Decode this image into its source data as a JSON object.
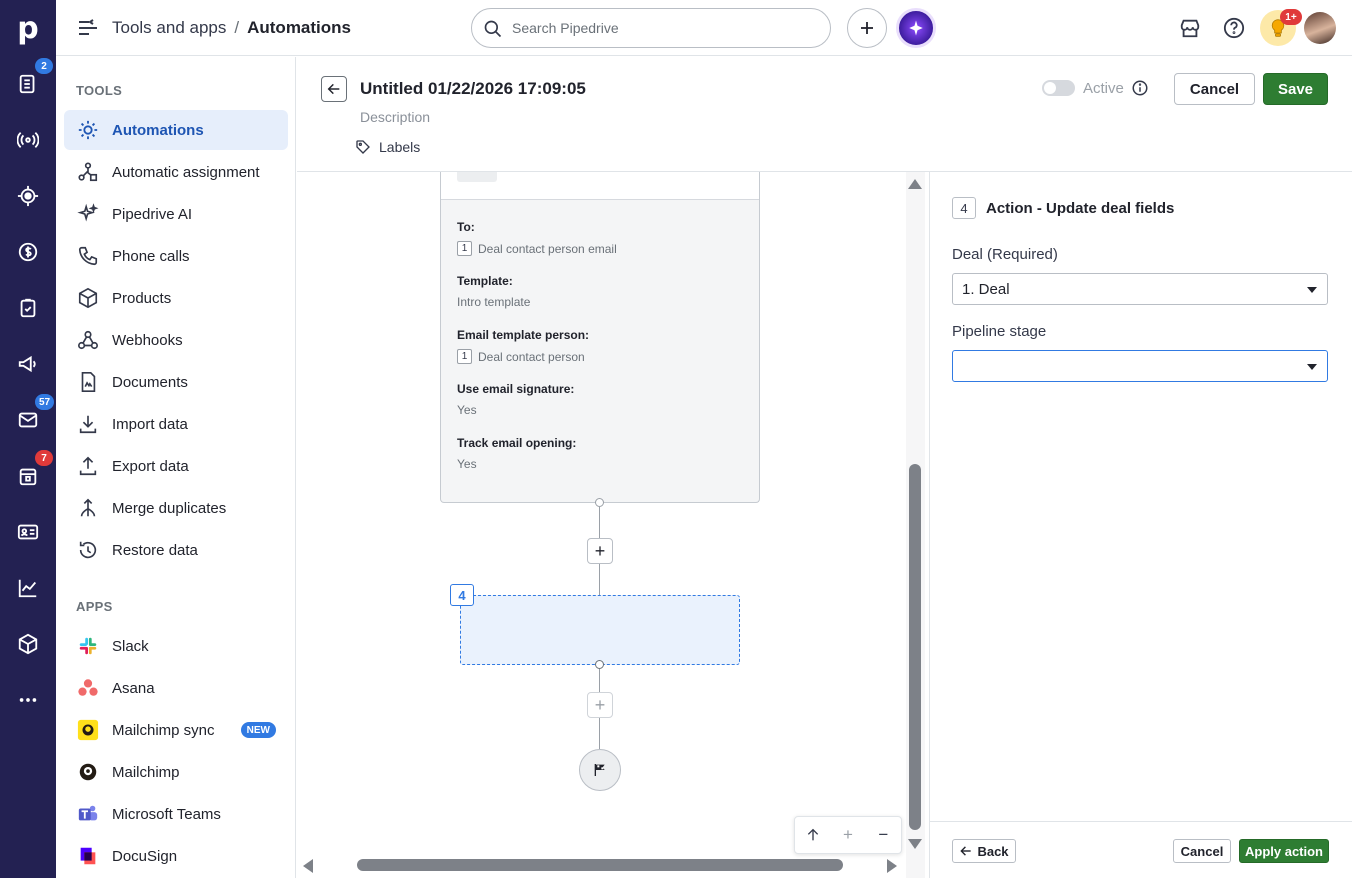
{
  "rail": {
    "logo": "p",
    "badges": {
      "deals": "2",
      "mail": "57",
      "calendar": "7"
    }
  },
  "header": {
    "breadcrumb_parent": "Tools and apps",
    "breadcrumb_sep": "/",
    "breadcrumb_current": "Automations",
    "search_placeholder": "Search Pipedrive",
    "notifications_badge": "1+"
  },
  "sidenav": {
    "tools_title": "TOOLS",
    "tools": [
      {
        "label": "Automations",
        "icon": "automation-icon"
      },
      {
        "label": "Automatic assignment",
        "icon": "assignment-icon"
      },
      {
        "label": "Pipedrive AI",
        "icon": "sparkle-icon"
      },
      {
        "label": "Phone calls",
        "icon": "phone-icon"
      },
      {
        "label": "Products",
        "icon": "box-icon"
      },
      {
        "label": "Webhooks",
        "icon": "webhook-icon"
      },
      {
        "label": "Documents",
        "icon": "document-icon"
      },
      {
        "label": "Import data",
        "icon": "import-icon"
      },
      {
        "label": "Export data",
        "icon": "export-icon"
      },
      {
        "label": "Merge duplicates",
        "icon": "merge-icon"
      },
      {
        "label": "Restore data",
        "icon": "restore-icon"
      }
    ],
    "apps_title": "APPS",
    "apps": [
      {
        "label": "Slack",
        "icon": "slack-icon"
      },
      {
        "label": "Asana",
        "icon": "asana-icon"
      },
      {
        "label": "Mailchimp sync",
        "icon": "mailchimp-icon",
        "badge": "NEW"
      },
      {
        "label": "Mailchimp",
        "icon": "mailchimp-icon"
      },
      {
        "label": "Microsoft Teams",
        "icon": "teams-icon"
      },
      {
        "label": "DocuSign",
        "icon": "docusign-icon"
      }
    ]
  },
  "editor": {
    "title": "Untitled 01/22/2026 17:09:05",
    "description_placeholder": "Description",
    "labels": "Labels",
    "active_label": "Active",
    "cancel": "Cancel",
    "save": "Save"
  },
  "card": {
    "to_label": "To:",
    "to_num": "1",
    "to_value": "Deal contact person email",
    "template_label": "Template:",
    "template_value": "Intro template",
    "person_label": "Email template person:",
    "person_num": "1",
    "person_value": "Deal contact person",
    "signature_label": "Use email signature:",
    "signature_value": "Yes",
    "tracking_label": "Track email opening:",
    "tracking_value": "Yes"
  },
  "canvas": {
    "new_step_number": "4"
  },
  "panel": {
    "step_number": "4",
    "title": "Action - Update deal fields",
    "deal_label": "Deal (Required)",
    "deal_value": "1. Deal",
    "stage_label": "Pipeline stage",
    "stage_value": "",
    "back": "Back",
    "cancel": "Cancel",
    "apply": "Apply action"
  },
  "colors": {
    "rail_bg": "#232152",
    "accent_blue": "#317ae2",
    "save_green": "#2e7d32",
    "active_nav_bg": "#e6eefb"
  }
}
